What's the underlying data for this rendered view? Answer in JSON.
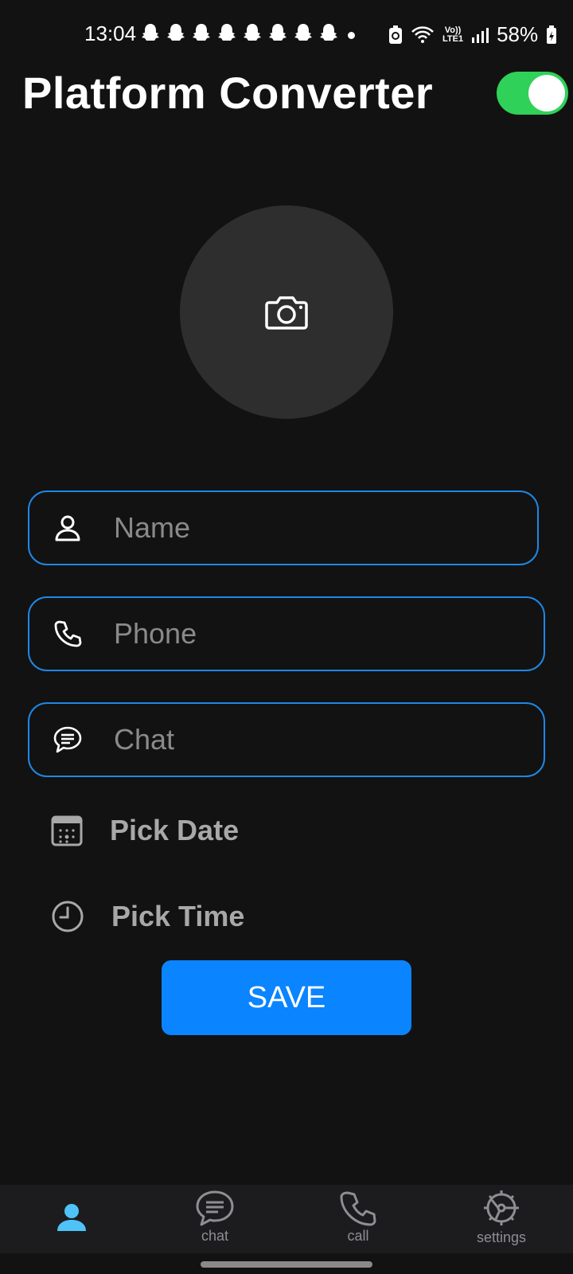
{
  "status_bar": {
    "time": "13:04",
    "battery": "58%",
    "network": "LTE1",
    "volte": "Vo))",
    "icons": [
      "snapchat-icon",
      "recycle-icon",
      "wifi-icon",
      "signal-icon",
      "battery-charging-icon"
    ]
  },
  "header": {
    "title": "Platform Converter",
    "toggle_on": true,
    "toggle_color": "#30d158"
  },
  "avatar": {
    "icon": "camera-icon"
  },
  "form": {
    "name_placeholder": "Name",
    "phone_placeholder": "Phone",
    "chat_placeholder": "Chat",
    "pick_date": "Pick Date",
    "pick_time": "Pick Time",
    "save": "SAVE"
  },
  "bottom_nav": {
    "items": [
      {
        "icon": "person-icon",
        "label": "",
        "active": true
      },
      {
        "icon": "chat-icon",
        "label": "chat",
        "active": false
      },
      {
        "icon": "phone-icon",
        "label": "call",
        "active": false
      },
      {
        "icon": "settings-icon",
        "label": "settings",
        "active": false
      }
    ]
  },
  "colors": {
    "background": "#121212",
    "accent": "#1e88e5",
    "button": "#0a84ff",
    "active_nav": "#4fc3f7"
  }
}
